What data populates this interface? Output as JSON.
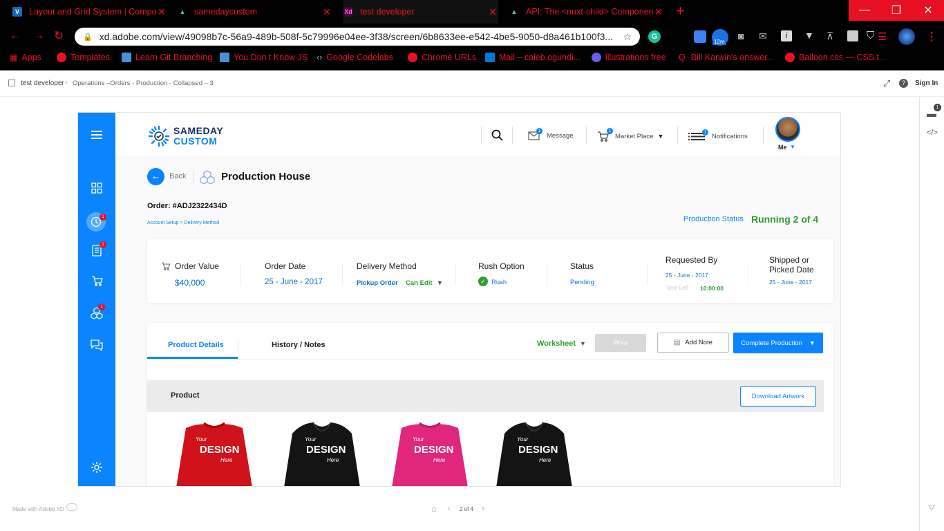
{
  "browser": {
    "tabs": [
      {
        "title": "Layout and Grid System | Compo",
        "icon": "vuetify-icon",
        "fav_bg": "#1867c0",
        "fav_text": "V"
      },
      {
        "title": "samedaycustom",
        "icon": "nuxt-icon",
        "fav_bg": "#000",
        "fav_text": "▲"
      },
      {
        "title": "test developer",
        "icon": "adobe-xd-icon",
        "fav_bg": "#470137",
        "fav_text": "Xd"
      },
      {
        "title": "API: The <nuxt-child> Componen",
        "icon": "nuxt-icon",
        "fav_bg": "#000",
        "fav_text": "▲"
      }
    ],
    "new_tab": "+",
    "window_controls": {
      "minimize": "—",
      "restore": "❐",
      "close": "✕"
    },
    "url": "xd.adobe.com/view/49098b7c-56a9-489b-508f-5c79996e04ee-3f38/screen/6b8633ee-e542-4be5-9050-d8a461b100f3...",
    "ext_badge": "12m",
    "bookmarks": [
      {
        "label": "Apps",
        "color": "#e81123"
      },
      {
        "label": "Templates",
        "color": "#e81123"
      },
      {
        "label": "Learn Git Branching",
        "color": "#4a90d9"
      },
      {
        "label": "You Don t Know JS",
        "color": "#4a90d9"
      },
      {
        "label": "Google Codelabs",
        "color": "#888"
      },
      {
        "label": "Chrome URLs",
        "color": "#e81123"
      },
      {
        "label": "Mail – caleb.ogundi...",
        "color": "#0078d4"
      },
      {
        "label": "illustrations free",
        "color": "#6c5ce7"
      },
      {
        "label": "Bill Karwin's answer...",
        "color": "#e81123"
      },
      {
        "label": "Balloon.css — CSS t...",
        "color": "#e81123"
      }
    ]
  },
  "xd": {
    "breadcrumb_root": "test developer",
    "breadcrumb_screen": "Operations –Orders - Production - Collapsed – 3",
    "sign_in": "Sign In",
    "comment_count": "1",
    "made_with": "Made with Adobe XD",
    "pager": "2 of 4"
  },
  "app": {
    "logo_line1": "SAMEDAY",
    "logo_line2": "CUSTOM",
    "nav": {
      "message": "Message",
      "message_badge": "1",
      "market_place": "Market Place",
      "market_badge": "1",
      "notifications": "Notifications",
      "notifications_badge": "1",
      "me": "Me"
    },
    "sidebar_badges": {
      "orders": "1",
      "list": "1",
      "box": "1"
    },
    "back": "Back",
    "page_title": "Production House",
    "order_id": "Order: #ADJ2322434D",
    "sub_breadcrumb": "Account Setup > Delivery Method",
    "production_status_label": "Production Status",
    "production_status_value": "Running 2 of 4",
    "info": {
      "order_value_label": "Order Value",
      "order_value": "$40,000",
      "order_date_label": "Order Date",
      "order_date": "25 - June - 2017",
      "delivery_label": "Delivery Method",
      "delivery_value": "Pickup Order",
      "delivery_edit": "Can Edit",
      "rush_label": "Rush Option",
      "rush_value": "Rush",
      "status_label": "Status",
      "status_value": "Pending",
      "requested_label": "Requested By",
      "requested_date": "25 - June - 2017",
      "time_left_label": "Time Left",
      "time_left": "10:00:00",
      "shipped_label_1": "Shipped or",
      "shipped_label_2": "Picked Date",
      "shipped_date": "25 - June - 2017"
    },
    "tabs": {
      "product_details": "Product Details",
      "history": "History / Notes"
    },
    "actions": {
      "worksheet": "Worksheet",
      "print": "Print",
      "add_note": "Add Note",
      "complete": "Complete Production"
    },
    "product_header": "Product",
    "download_artwork": "Download Artwork",
    "products": [
      {
        "color": "#d0121b",
        "line1": "Your",
        "line2": "DESIGN",
        "line3": "Here"
      },
      {
        "color": "#141414",
        "line1": "Your",
        "line2": "DESIGN",
        "line3": "Here"
      },
      {
        "color": "#e0277d",
        "line1": "Your",
        "line2": "DESIGN",
        "line3": "Here"
      },
      {
        "color": "#141414",
        "line1": "Your",
        "line2": "DESIGN",
        "line3": "Here"
      }
    ],
    "colors": {
      "primary": "#0a84ff",
      "green": "#2e9e2e",
      "alert": "#e81123"
    }
  }
}
